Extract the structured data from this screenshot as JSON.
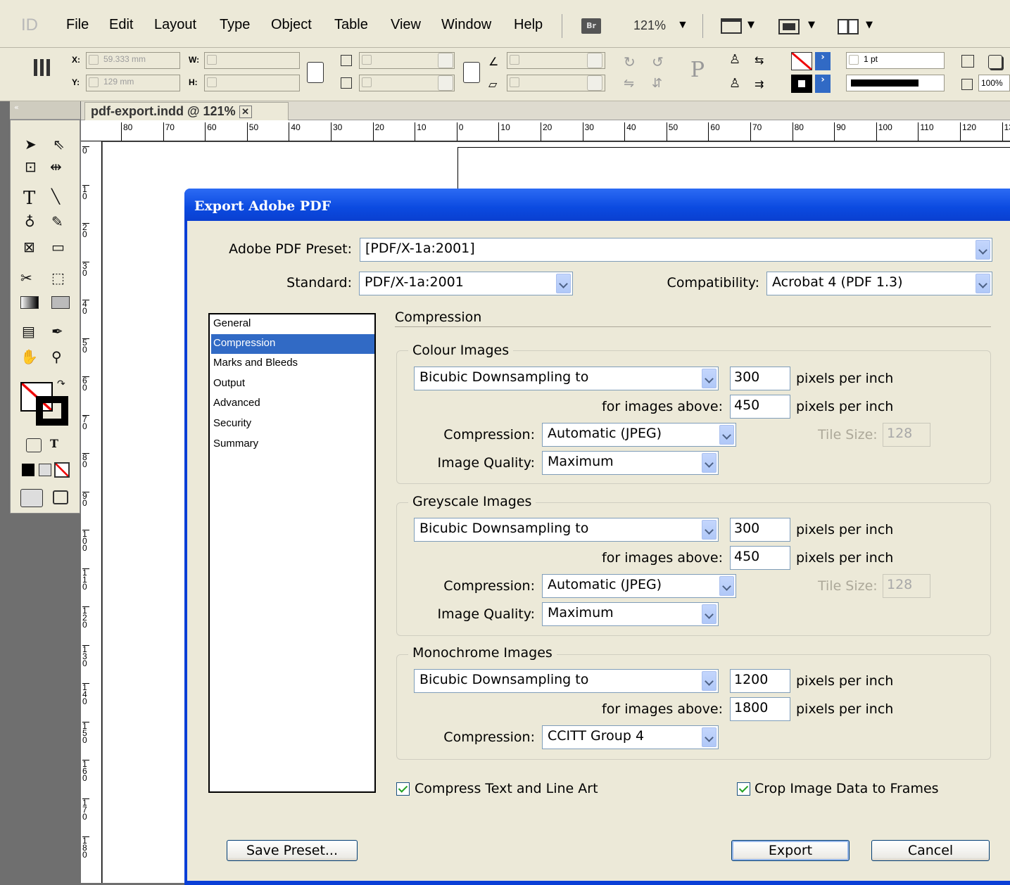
{
  "menubar": {
    "logo": "ID",
    "items": [
      "File",
      "Edit",
      "Layout",
      "Type",
      "Object",
      "Table",
      "View",
      "Window",
      "Help"
    ],
    "bridge": "Br",
    "zoom": "121%",
    "zoom_arrow": "▼"
  },
  "control": {
    "x_label": "X:",
    "x_value": "59.333 mm",
    "y_label": "Y:",
    "y_value": "129 mm",
    "w_label": "W:",
    "h_label": "H:",
    "stroke_weight": "1 pt",
    "opacity": "100%"
  },
  "document": {
    "tab_title": "pdf-export.indd @ 121%",
    "hruler": [
      "80",
      "70",
      "60",
      "50",
      "40",
      "30",
      "20",
      "10",
      "0",
      "10",
      "20",
      "30",
      "40",
      "50",
      "60",
      "70",
      "80",
      "90",
      "100",
      "110",
      "120",
      "13"
    ],
    "vruler": [
      "0",
      "1 0",
      "2 0",
      "3 0",
      "4 0",
      "5 0",
      "6 0",
      "7 0",
      "8 0",
      "9 0",
      "1 0 0",
      "1 1 0",
      "1 2 0",
      "1 3 0",
      "1 4 0",
      "1 5 0",
      "1 6 0",
      "1 7 0",
      "1 8 0"
    ]
  },
  "dialog": {
    "title": "Export Adobe PDF",
    "preset_label": "Adobe PDF Preset:",
    "preset_value": "[PDF/X-1a:2001]",
    "standard_label": "Standard:",
    "standard_value": "PDF/X-1a:2001",
    "compat_label": "Compatibility:",
    "compat_value": "Acrobat 4 (PDF 1.3)",
    "nav": [
      "General",
      "Compression",
      "Marks and Bleeds",
      "Output",
      "Advanced",
      "Security",
      "Summary"
    ],
    "section_title": "Compression",
    "colour": {
      "title": "Colour Images",
      "method": "Bicubic Downsampling to",
      "ppi": "300",
      "ppi_unit": "pixels per inch",
      "above_label": "for images above:",
      "above": "450",
      "above_unit": "pixels per inch",
      "compression_label": "Compression:",
      "compression": "Automatic (JPEG)",
      "tile_label": "Tile Size:",
      "tile": "128",
      "quality_label": "Image Quality:",
      "quality": "Maximum"
    },
    "grey": {
      "title": "Greyscale Images",
      "method": "Bicubic Downsampling to",
      "ppi": "300",
      "ppi_unit": "pixels per inch",
      "above_label": "for images above:",
      "above": "450",
      "above_unit": "pixels per inch",
      "compression_label": "Compression:",
      "compression": "Automatic (JPEG)",
      "tile_label": "Tile Size:",
      "tile": "128",
      "quality_label": "Image Quality:",
      "quality": "Maximum"
    },
    "mono": {
      "title": "Monochrome Images",
      "method": "Bicubic Downsampling to",
      "ppi": "1200",
      "ppi_unit": "pixels per inch",
      "above_label": "for images above:",
      "above": "1800",
      "above_unit": "pixels per inch",
      "compression_label": "Compression:",
      "compression": "CCITT Group 4"
    },
    "compress_text": "Compress Text and Line Art",
    "crop_image": "Crop Image Data to Frames",
    "save_preset": "Save Preset...",
    "export": "Export",
    "cancel": "Cancel"
  }
}
